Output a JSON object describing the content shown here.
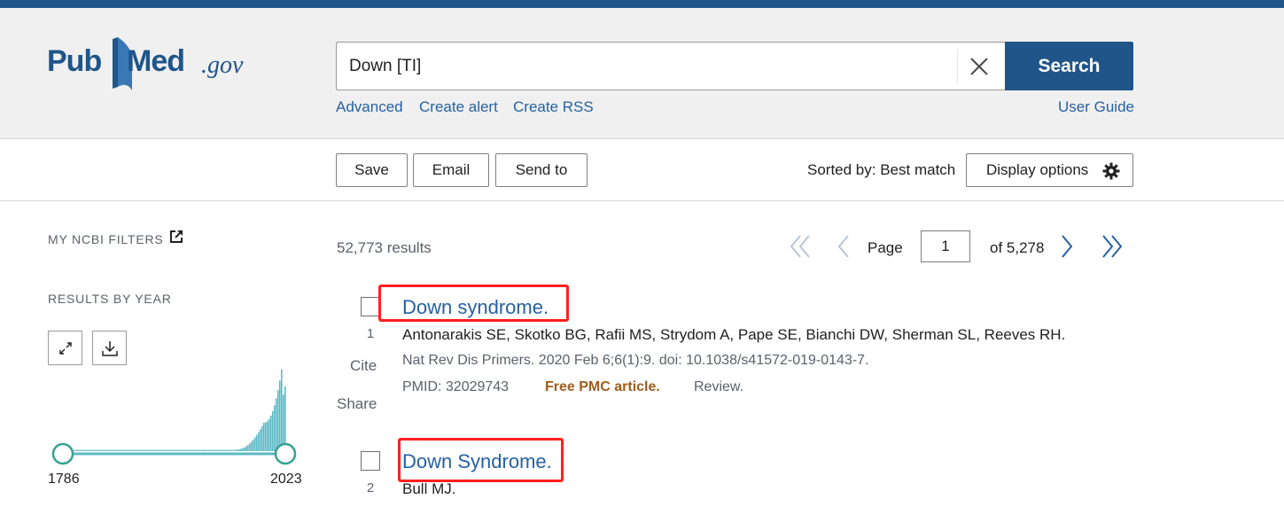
{
  "header": {
    "logo_pub": "Pub",
    "logo_med": "Med",
    "logo_gov": ".gov",
    "search_value": "Down [TI]",
    "search_button": "Search",
    "links": {
      "advanced": "Advanced",
      "create_alert": "Create alert",
      "create_rss": "Create RSS",
      "user_guide": "User Guide"
    }
  },
  "toolbar": {
    "save": "Save",
    "email": "Email",
    "send_to": "Send to",
    "sorted_by": "Sorted by: Best match",
    "display_options": "Display options"
  },
  "sidebar": {
    "my_filters": "MY NCBI FILTERS",
    "results_by_year": "RESULTS BY YEAR",
    "year_start": "1786",
    "year_end": "2023"
  },
  "results": {
    "count": "52,773 results",
    "page_label": "Page",
    "page_value": "1",
    "of_pages": "of 5,278",
    "items": [
      {
        "number": "1",
        "title": "Down syndrome.",
        "authors": "Antonarakis SE, Skotko BG, Rafii MS, Strydom A, Pape SE, Bianchi DW, Sherman SL, Reeves RH.",
        "citation": "Nat Rev Dis Primers. 2020 Feb 6;6(1):9. doi: 10.1038/s41572-019-0143-7.",
        "pmid": "PMID: 32029743",
        "free": "Free PMC article.",
        "type": "Review.",
        "cite": "Cite",
        "share": "Share"
      },
      {
        "number": "2",
        "title": "Down Syndrome.",
        "authors": "Bull MJ."
      }
    ]
  },
  "colors": {
    "brand": "#20558a",
    "link": "#2561a3",
    "free_article": "#a05c1b",
    "highlight": "#ff1f1f",
    "histogram": "#5bb8c4"
  }
}
